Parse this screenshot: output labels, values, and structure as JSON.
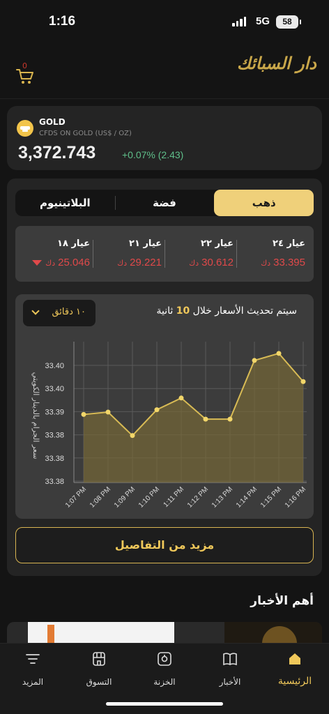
{
  "status": {
    "time": "1:16",
    "network": "5G",
    "battery": "58"
  },
  "header": {
    "cart_count": "0",
    "logo_text": "دار السبائك"
  },
  "ticker": {
    "name": "GOLD",
    "subtitle": "CFDS ON GOLD (US$ / OZ)",
    "price": "3,372.743",
    "change": "+0.07% (2.43)",
    "change_color": "#5fbf8a"
  },
  "metal_tabs": [
    {
      "label": "ذهب",
      "active": true
    },
    {
      "label": "فضة",
      "active": false
    },
    {
      "label": "البلاتينيوم",
      "active": false
    }
  ],
  "karats": [
    {
      "label": "عيار ٢٤",
      "value": "33.395",
      "unit": "دك"
    },
    {
      "label": "عيار ٢٢",
      "value": "30.612",
      "unit": "دك"
    },
    {
      "label": "عيار ٢١",
      "value": "29.221",
      "unit": "دك"
    },
    {
      "label": "عيار ١٨",
      "value": "25.046",
      "unit": "دك"
    }
  ],
  "price_color": "#e0494a",
  "chart_controls": {
    "interval": "١٠ دقائق",
    "refresh_prefix": "سيتم تحديث الأسعار خلال",
    "refresh_seconds": "10",
    "refresh_suffix": "ثانية"
  },
  "chart_data": {
    "type": "area",
    "ylabel": "سعر الجرام بالدينار الكويتي",
    "x": [
      "1:07 PM",
      "1:08 PM",
      "1:09 PM",
      "1:10 PM",
      "1:11 PM",
      "1:12 PM",
      "1:13 PM",
      "1:14 PM",
      "1:15 PM",
      "1:16 PM"
    ],
    "values": [
      33.386,
      33.387,
      33.377,
      33.388,
      33.393,
      33.384,
      33.384,
      33.409,
      33.412,
      33.4
    ],
    "y_ticks": [
      "33.40",
      "33.40",
      "33.39",
      "33.38",
      "33.38",
      "33.38"
    ],
    "ylim": [
      33.357,
      33.417
    ],
    "grid": true,
    "accent": "#d8bb55"
  },
  "more_button": "مزيد من التفاصيل",
  "news": {
    "title": "أهم الأخبار"
  },
  "bottom_nav": [
    {
      "label": "الرئيسية",
      "icon": "home-icon",
      "active": true
    },
    {
      "label": "الأخبار",
      "icon": "book-icon",
      "active": false
    },
    {
      "label": "الخزنة",
      "icon": "vault-icon",
      "active": false
    },
    {
      "label": "التسوق",
      "icon": "store-icon",
      "active": false
    },
    {
      "label": "المزيد",
      "icon": "menu-icon",
      "active": false
    }
  ]
}
